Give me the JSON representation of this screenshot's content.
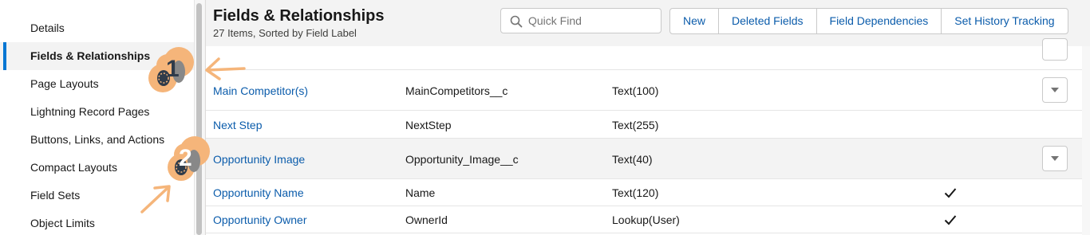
{
  "sidebar": {
    "items": [
      {
        "label": "Details"
      },
      {
        "label": "Fields & Relationships"
      },
      {
        "label": "Page Layouts"
      },
      {
        "label": "Lightning Record Pages"
      },
      {
        "label": "Buttons, Links, and Actions"
      },
      {
        "label": "Compact Layouts"
      },
      {
        "label": "Field Sets"
      },
      {
        "label": "Object Limits"
      }
    ],
    "active_index": 1
  },
  "header": {
    "title": "Fields & Relationships",
    "subtitle": "27 Items, Sorted by Field Label",
    "search_placeholder": "Quick Find",
    "buttons": [
      "New",
      "Deleted Fields",
      "Field Dependencies",
      "Set History Tracking"
    ]
  },
  "table": {
    "rows": [
      {
        "label": "Main Competitor(s)",
        "api_name": "MainCompetitors__c",
        "type": "Text(100)",
        "indexed": false,
        "has_menu": true
      },
      {
        "label": "Next Step",
        "api_name": "NextStep",
        "type": "Text(255)",
        "indexed": false,
        "has_menu": false
      },
      {
        "label": "Opportunity Image",
        "api_name": "Opportunity_Image__c",
        "type": "Text(40)",
        "indexed": false,
        "has_menu": true,
        "highlighted": true
      },
      {
        "label": "Opportunity Name",
        "api_name": "Name",
        "type": "Text(120)",
        "indexed": true,
        "has_menu": false
      },
      {
        "label": "Opportunity Owner",
        "api_name": "OwnerId",
        "type": "Lookup(User)",
        "indexed": true,
        "has_menu": false
      }
    ]
  },
  "annotations": {
    "step1": "1",
    "step2": "2",
    "accent_color": "#f5b57a"
  },
  "colors": {
    "link": "#0b5cab",
    "active_marker": "#0176d3",
    "header_bg": "#f3f3f3"
  }
}
